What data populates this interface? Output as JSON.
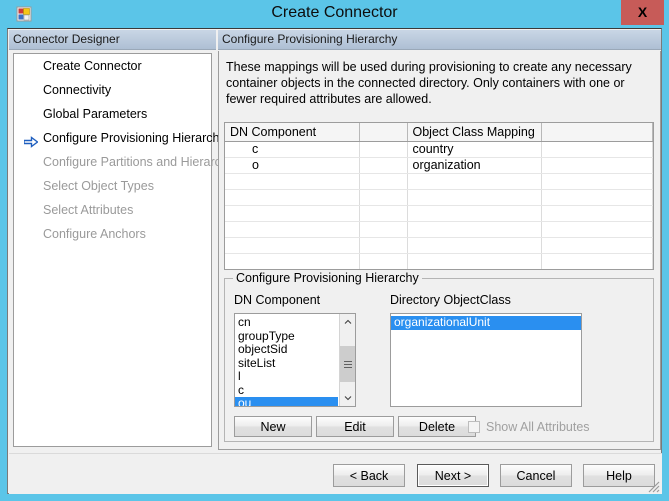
{
  "window": {
    "title": "Create Connector",
    "icon": "connector-icon",
    "close_label": "X",
    "close_color": "#c75b58",
    "frame_color": "#5bc5e8"
  },
  "sidebar": {
    "header": "Connector Designer",
    "items": [
      {
        "label": "Create Connector",
        "state": "done",
        "current": false
      },
      {
        "label": "Connectivity",
        "state": "done",
        "current": false
      },
      {
        "label": "Global Parameters",
        "state": "done",
        "current": false
      },
      {
        "label": "Configure Provisioning Hierarchy",
        "state": "done",
        "current": true
      },
      {
        "label": "Configure Partitions and Hierarchies",
        "state": "disabled",
        "current": false
      },
      {
        "label": "Select Object Types",
        "state": "disabled",
        "current": false
      },
      {
        "label": "Select Attributes",
        "state": "disabled",
        "current": false
      },
      {
        "label": "Configure Anchors",
        "state": "disabled",
        "current": false
      }
    ]
  },
  "main": {
    "header": "Configure Provisioning Hierarchy",
    "description": "These mappings will be used during provisioning to create any necessary container objects in the connected directory.  Only containers with one or fewer required attributes are allowed.",
    "grid": {
      "columns": [
        "DN Component",
        "",
        "Object Class Mapping",
        ""
      ],
      "rows": [
        {
          "dn": "c",
          "blank": "",
          "mapping": "country",
          "extra": ""
        },
        {
          "dn": "o",
          "blank": "",
          "mapping": "organization",
          "extra": ""
        }
      ],
      "empty_row_count": 9
    },
    "groupbox": {
      "legend": "Configure Provisioning Hierarchy",
      "dn_label": "DN Component",
      "objectclass_label": "Directory ObjectClass",
      "dn_items": [
        {
          "label": "cn",
          "selected": false
        },
        {
          "label": "groupType",
          "selected": false
        },
        {
          "label": "objectSid",
          "selected": false
        },
        {
          "label": "siteList",
          "selected": false
        },
        {
          "label": "l",
          "selected": false
        },
        {
          "label": "c",
          "selected": false
        },
        {
          "label": "ou",
          "selected": true
        }
      ],
      "objectclass_items": [
        {
          "label": "organizationalUnit",
          "selected": true
        }
      ],
      "buttons": {
        "new": "New",
        "edit": "Edit",
        "delete": "Delete"
      },
      "checkbox": {
        "label": "Show All Attributes",
        "checked": false,
        "enabled": false
      }
    }
  },
  "footer": {
    "back": "< Back",
    "next": "Next  >",
    "cancel": "Cancel",
    "help": "Help",
    "default_button": "next"
  },
  "colors": {
    "selection_blue": "#2a8ff0",
    "panel_header_top": "#c9d6e5",
    "panel_header_bottom": "#aebfd4",
    "dialog_bg": "#f0f0f0"
  }
}
